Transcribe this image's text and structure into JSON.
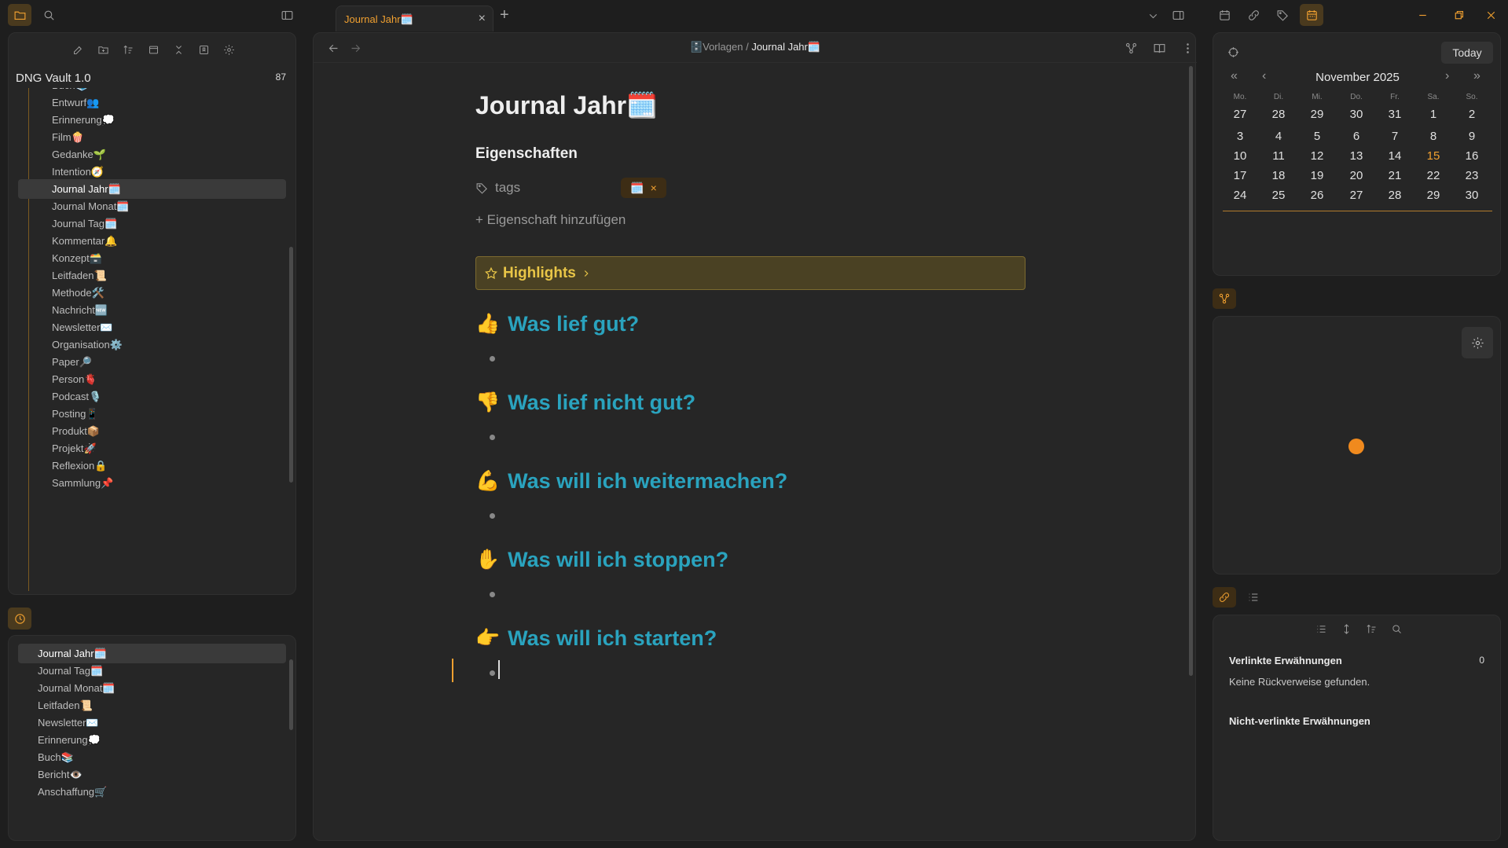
{
  "tab": {
    "title": "Journal Jahr🗓️"
  },
  "left_sidebar": {
    "vault_name": "DNG Vault 1.0",
    "vault_count": "87",
    "tree_items": [
      {
        "label": "Buch📚"
      },
      {
        "label": "Entwurf👥"
      },
      {
        "label": "Erinnerung💭"
      },
      {
        "label": "Film🍿"
      },
      {
        "label": "Gedanke🌱"
      },
      {
        "label": "Intention🧭"
      },
      {
        "label": "Journal Jahr🗓️"
      },
      {
        "label": "Journal Monat🗓️"
      },
      {
        "label": "Journal Tag🗓️"
      },
      {
        "label": "Kommentar🔔"
      },
      {
        "label": "Konzept🗃️"
      },
      {
        "label": "Leitfaden📜"
      },
      {
        "label": "Methode🛠️"
      },
      {
        "label": "Nachricht🆕"
      },
      {
        "label": "Newsletter✉️"
      },
      {
        "label": "Organisation⚙️"
      },
      {
        "label": "Paper🔎"
      },
      {
        "label": "Person🫀"
      },
      {
        "label": "Podcast🎙️"
      },
      {
        "label": "Posting📱"
      },
      {
        "label": "Produkt📦"
      },
      {
        "label": "Projekt🚀"
      },
      {
        "label": "Reflexion🔒"
      },
      {
        "label": "Sammlung📌"
      }
    ],
    "selected_tree_index": 6,
    "recent_items": [
      {
        "label": "Journal Jahr🗓️"
      },
      {
        "label": "Journal Tag🗓️"
      },
      {
        "label": "Journal Monat🗓️"
      },
      {
        "label": "Leitfaden📜"
      },
      {
        "label": "Newsletter✉️"
      },
      {
        "label": "Erinnerung💭"
      },
      {
        "label": "Buch📚"
      },
      {
        "label": "Bericht👁️"
      },
      {
        "label": "Anschaffung🛒"
      }
    ]
  },
  "editor": {
    "breadcrumb_parent": "🗄️Vorlagen",
    "breadcrumb_sep": "/",
    "breadcrumb_current": "Journal Jahr🗓️",
    "note_title": "Journal Jahr🗓️",
    "properties_heading": "Eigenschaften",
    "prop_key": "tags",
    "tag_value": "🗓️",
    "tag_remove": "×",
    "add_property": "+ Eigenschaft hinzufügen",
    "callout_title": "Highlights",
    "sections": [
      {
        "emoji": "👍",
        "title": "Was lief gut?"
      },
      {
        "emoji": "👎",
        "title": "Was lief nicht gut?"
      },
      {
        "emoji": "💪",
        "title": "Was will ich weitermachen?"
      },
      {
        "emoji": "✋",
        "title": "Was will ich stoppen?"
      },
      {
        "emoji": "👉",
        "title": "Was will ich starten?"
      }
    ]
  },
  "calendar": {
    "today_label": "Today",
    "month": "November",
    "year": "2025",
    "weekdays": [
      "Mo.",
      "Di.",
      "Mi.",
      "Do.",
      "Fr.",
      "Sa.",
      "So."
    ],
    "weeks": [
      [
        "27",
        "28",
        "29",
        "30",
        "31",
        "1",
        "2"
      ],
      [
        "3",
        "4",
        "5",
        "6",
        "7",
        "8",
        "9"
      ],
      [
        "10",
        "11",
        "12",
        "13",
        "14",
        "15",
        "16"
      ],
      [
        "17",
        "18",
        "19",
        "20",
        "21",
        "22",
        "23"
      ],
      [
        "24",
        "25",
        "26",
        "27",
        "28",
        "29",
        "30"
      ]
    ],
    "today_day": "15"
  },
  "backlinks": {
    "linked_heading": "Verlinkte Erwähnungen",
    "linked_count": "0",
    "empty_text": "Keine Rückverweise gefunden.",
    "unlinked_heading": "Nicht-verlinkte Erwähnungen"
  },
  "colors": {
    "accent": "#f0a030",
    "heading": "#2aa3be",
    "callout_bg": "#4a4123",
    "callout_text": "#e8c547"
  }
}
